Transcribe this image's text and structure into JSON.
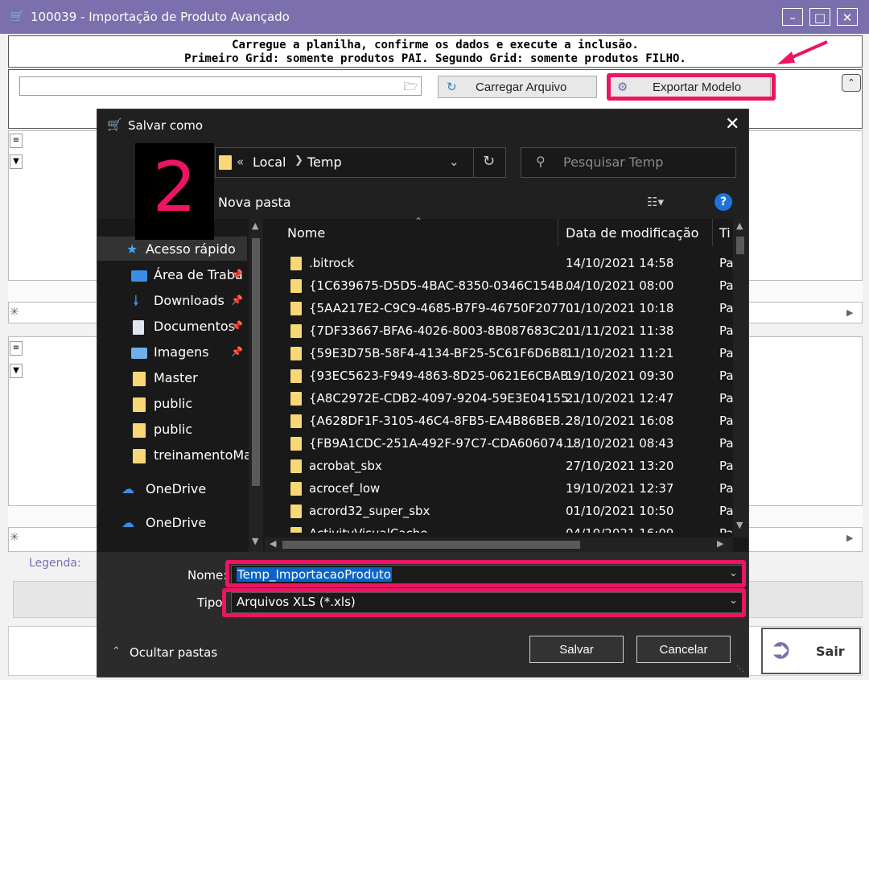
{
  "app": {
    "title": "100039 - Importação de Produto Avançado",
    "instructions_line1": "Carregue a planilha, confirme os dados e execute a inclusão.",
    "instructions_line2": "Primeiro Grid: somente produtos PAI. Segundo Grid: somente produtos FILHO.",
    "carregar_label": "Carregar Arquivo",
    "exportar_label": "Exportar Modelo",
    "legenda_label": "Legenda:",
    "sair_label": "Sair",
    "accent_color": "#7b6fae",
    "highlight_color": "#ec1463"
  },
  "annotation": {
    "step_number": "2"
  },
  "dialog": {
    "title": "Salvar como",
    "breadcrumb": [
      "Local",
      "Temp"
    ],
    "breadcrumb_overflow": "«",
    "search_placeholder": "Pesquisar Temp",
    "new_folder_label": "Nova pasta",
    "help_label": "?",
    "nav_items": [
      {
        "label": "Acesso rápido",
        "icon": "star-icon"
      },
      {
        "label": "Área de Traba",
        "icon": "desktop-icon",
        "pinned": true
      },
      {
        "label": "Downloads",
        "icon": "download-icon",
        "pinned": true
      },
      {
        "label": "Documentos",
        "icon": "document-icon",
        "pinned": true
      },
      {
        "label": "Imagens",
        "icon": "image-icon",
        "pinned": true
      },
      {
        "label": "Master",
        "icon": "folder-icon"
      },
      {
        "label": "public",
        "icon": "folder-icon"
      },
      {
        "label": "public",
        "icon": "folder-icon"
      },
      {
        "label": "treinamentoMas",
        "icon": "folder-icon"
      },
      {
        "label": "OneDrive",
        "icon": "cloud-icon"
      },
      {
        "label": "OneDrive",
        "icon": "cloud-icon"
      }
    ],
    "columns": {
      "name": "Nome",
      "date": "Data de modificação",
      "type": "Ti"
    },
    "files": [
      {
        "name": ".bitrock",
        "date": "14/10/2021 14:58",
        "type": "Pa"
      },
      {
        "name": "{1C639675-D5D5-4BAC-8350-0346C154B...",
        "date": "04/10/2021 08:00",
        "type": "Pa"
      },
      {
        "name": "{5AA217E2-C9C9-4685-B7F9-46750F2077...",
        "date": "01/10/2021 10:18",
        "type": "Pa"
      },
      {
        "name": "{7DF33667-BFA6-4026-8003-8B087683C2...",
        "date": "01/11/2021 11:38",
        "type": "Pa"
      },
      {
        "name": "{59E3D75B-58F4-4134-BF25-5C61F6D6B8...",
        "date": "11/10/2021 11:21",
        "type": "Pa"
      },
      {
        "name": "{93EC5623-F949-4863-8D25-0621E6CBAB...",
        "date": "19/10/2021 09:30",
        "type": "Pa"
      },
      {
        "name": "{A8C2972E-CDB2-4097-9204-59E3E04155...",
        "date": "21/10/2021 12:47",
        "type": "Pa"
      },
      {
        "name": "{A628DF1F-3105-46C4-8FB5-EA4B86BEB...",
        "date": "28/10/2021 16:08",
        "type": "Pa"
      },
      {
        "name": "{FB9A1CDC-251A-492F-97C7-CDA606074...",
        "date": "18/10/2021 08:43",
        "type": "Pa"
      },
      {
        "name": "acrobat_sbx",
        "date": "27/10/2021 13:20",
        "type": "Pa"
      },
      {
        "name": "acrocef_low",
        "date": "19/10/2021 12:37",
        "type": "Pa"
      },
      {
        "name": "acrord32_super_sbx",
        "date": "01/10/2021 10:50",
        "type": "Pa"
      },
      {
        "name": "ActivityVisualCache",
        "date": "04/10/2021 16:09",
        "type": "Pa"
      }
    ],
    "name_label": "Nome:",
    "name_value": "Temp_ImportacaoProduto",
    "type_label": "Tipo:",
    "type_value": "Arquivos XLS (*.xls)",
    "hide_folders_label": "Ocultar pastas",
    "save_label": "Salvar",
    "cancel_label": "Cancelar"
  }
}
